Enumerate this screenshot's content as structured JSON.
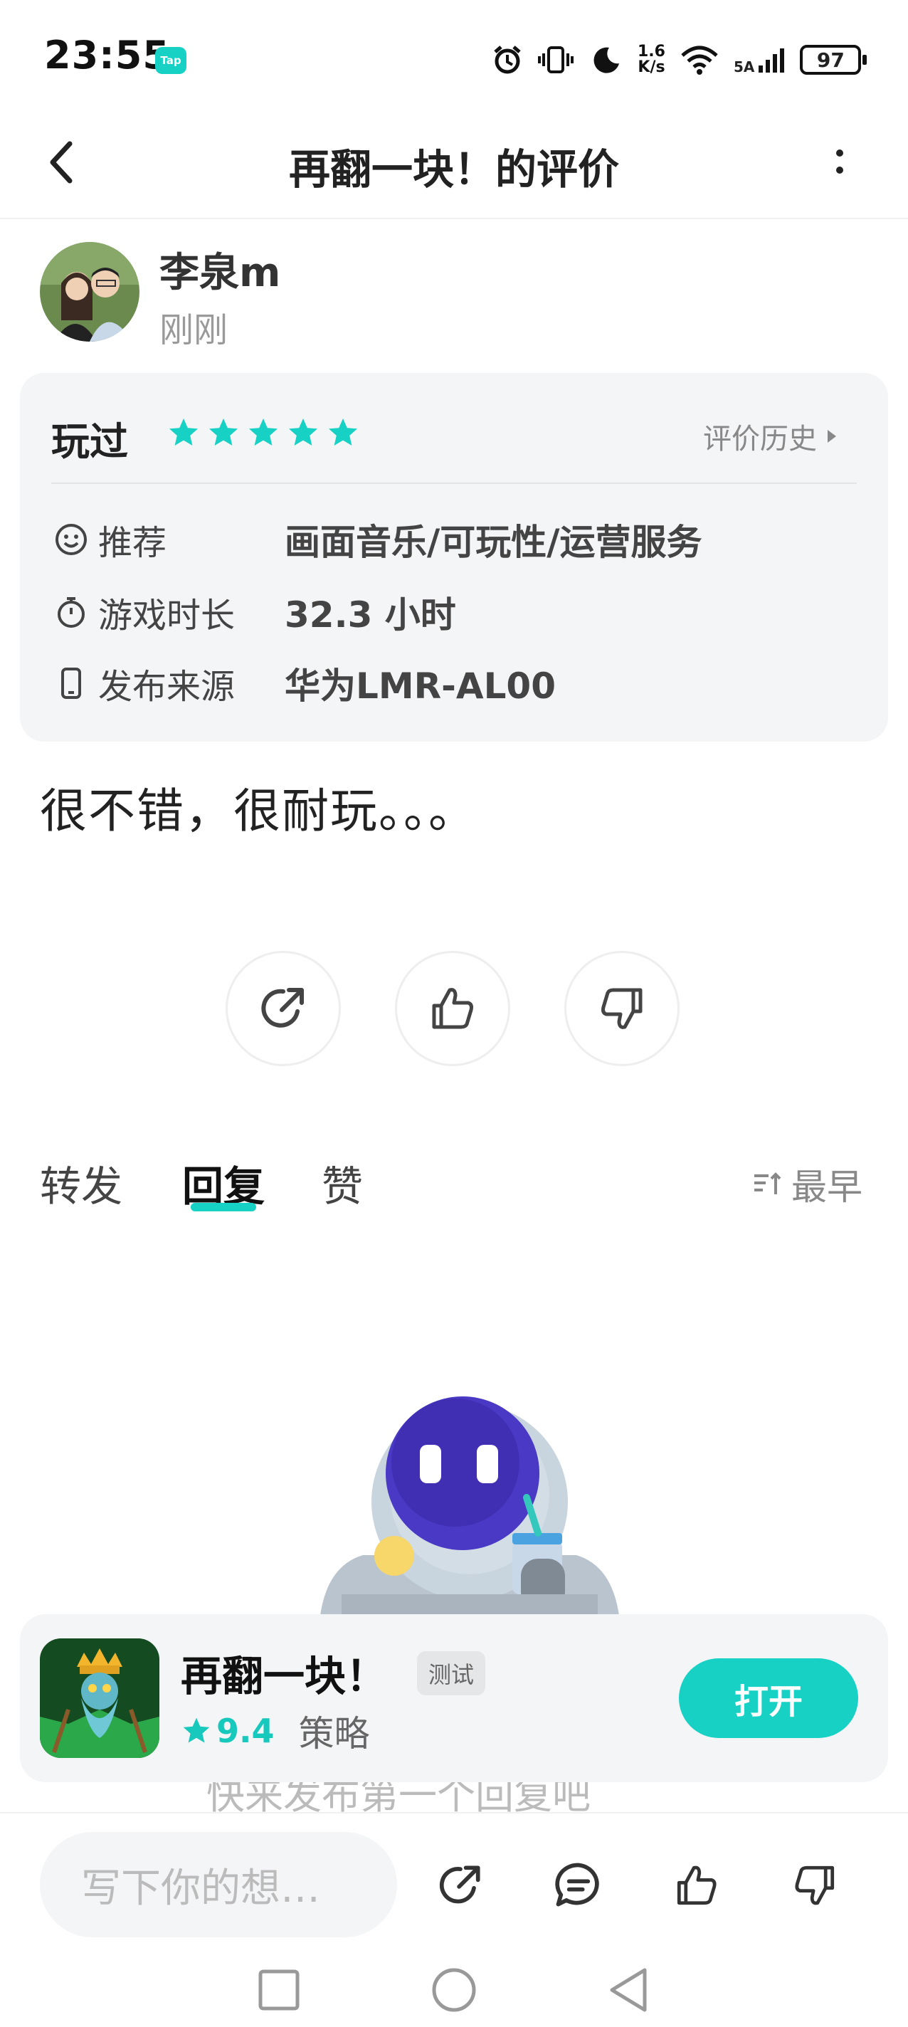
{
  "status_bar": {
    "time": "23:55",
    "tap_badge": "Tap",
    "net_speed_top": "1.6",
    "net_speed_bottom": "K/s",
    "signal_label": "5A",
    "battery": "97"
  },
  "header": {
    "title": "再翻一块！的评价",
    "back_icon": "back-arrow-icon",
    "more_icon": "more-vertical-icon"
  },
  "review": {
    "username": "李泉m",
    "time": "刚刚",
    "played_label": "玩过",
    "stars": 5,
    "history_label": "评价历史",
    "rows": [
      {
        "icon": "smile-icon",
        "label": "推荐",
        "value": "画面音乐/可玩性/运营服务"
      },
      {
        "icon": "stopwatch-icon",
        "label": "游戏时长",
        "value": "32.3 小时"
      },
      {
        "icon": "phone-icon",
        "label": "发布来源",
        "value": "华为LMR-AL00"
      }
    ],
    "text": "很不错，很耐玩。。。"
  },
  "tabs": {
    "items": [
      "转发",
      "回复",
      "赞"
    ],
    "active": "回复",
    "sort_label": "最早"
  },
  "empty_state": {
    "hint_text": "快来发布第一个回复吧"
  },
  "app_bar": {
    "name": "再翻一块！",
    "badge": "测试",
    "rating": "9.4",
    "category": "策略",
    "open_label": "打开"
  },
  "bottom_bar": {
    "input_placeholder": "写下你的想…"
  },
  "colors": {
    "accent": "#16d1c4",
    "card_bg": "#f4f5f7"
  }
}
